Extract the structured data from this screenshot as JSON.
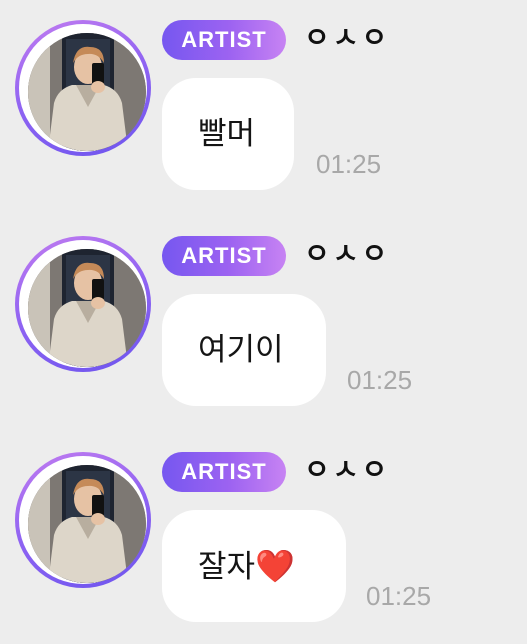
{
  "messages": [
    {
      "badge": "ARTIST",
      "sender": "ㅇㅅㅇ",
      "text": "빨머",
      "time": "01:25"
    },
    {
      "badge": "ARTIST",
      "sender": "ㅇㅅㅇ",
      "text": "여기이",
      "time": "01:25"
    },
    {
      "badge": "ARTIST",
      "sender": "ㅇㅅㅇ",
      "text": "잘자",
      "emoji": "❤️",
      "emoji_name": "red-heart-icon",
      "time": "01:25"
    }
  ],
  "colors": {
    "background": "#ededed",
    "bubble": "#ffffff",
    "badge_gradient_start": "#7657f0",
    "badge_gradient_end": "#c783f3",
    "ring_gradient_start": "#c27cf0",
    "ring_gradient_end": "#6d55ee",
    "timestamp": "#a8a8a8"
  }
}
